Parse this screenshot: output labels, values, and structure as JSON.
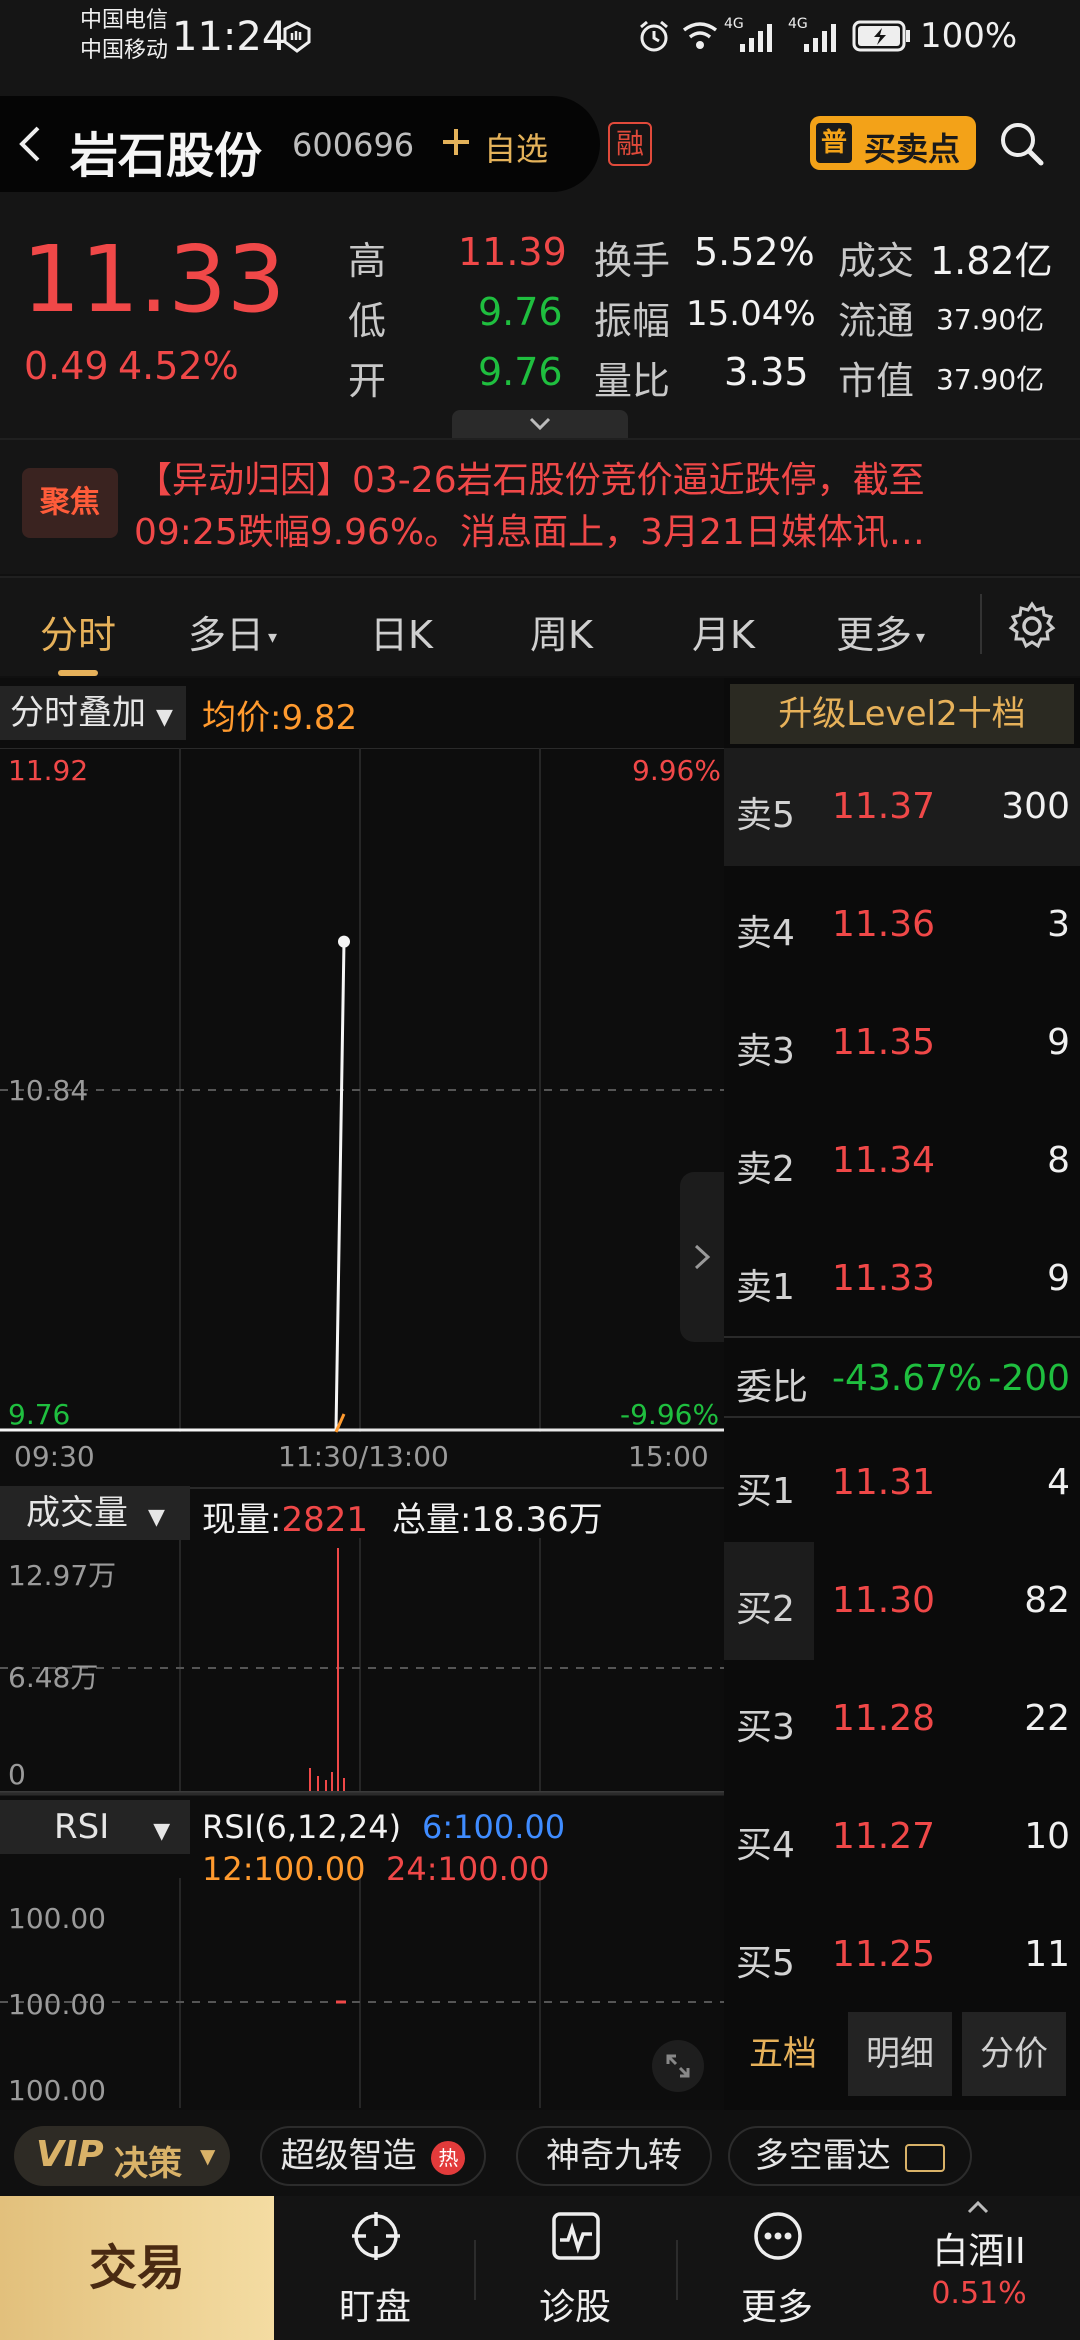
{
  "status_bar": {
    "carrier1": "中国电信",
    "carrier2": "中国移动",
    "time": "11:24",
    "network1": "4G",
    "network2": "4G",
    "battery": "100%"
  },
  "header": {
    "stock_name": "岩石股份",
    "stock_code": "600696",
    "add_watch": "自选",
    "margin_badge": "融",
    "buysell_prefix": "普",
    "buysell_label": "买卖点"
  },
  "quote": {
    "price": "11.33",
    "change": "0.49",
    "change_pct": "4.52%",
    "rows": [
      {
        "l1": "高",
        "v1": "11.39",
        "l2": "换手",
        "v2": "5.52%",
        "l3": "成交",
        "v3": "1.82亿"
      },
      {
        "l1": "低",
        "v1": "9.76",
        "l2": "振幅",
        "v2": "15.04%",
        "l3": "流通",
        "v3": "37.90亿"
      },
      {
        "l1": "开",
        "v1": "9.76",
        "l2": "量比",
        "v2": "3.35",
        "l3": "市值",
        "v3": "37.90亿"
      }
    ]
  },
  "news": {
    "badge": "聚焦",
    "line1": "【异动归因】03-26岩石股份竞价逼近跌停，截至",
    "line2": "09:25跌幅9.96%。消息面上，3月21日媒体讯…"
  },
  "tabs": [
    "分时",
    "多日",
    "日K",
    "周K",
    "月K",
    "更多"
  ],
  "chart": {
    "overlay_label": "分时叠加",
    "avg_label": "均价:9.82",
    "y_top": "11.92",
    "y_mid": "10.84",
    "y_bot": "9.76",
    "pct_top": "9.96%",
    "pct_bot": "-9.96%",
    "x_start": "09:30",
    "x_mid": "11:30/13:00",
    "x_end": "15:00",
    "volume_label": "成交量",
    "current_vol_label": "现量:",
    "current_vol": "2821",
    "total_vol": "总量:18.36万",
    "vol_top": "12.97万",
    "vol_mid": "6.48万",
    "vol_bot": "0",
    "rsi_label": "RSI",
    "rsi_params": "RSI(6,12,24)",
    "rsi6": "6:100.00",
    "rsi12": "12:100.00",
    "rsi24": "24:100.00",
    "rsi_top": "100.00",
    "rsi_mid": "100.00",
    "rsi_bot": "100.00"
  },
  "chart_data": {
    "type": "line",
    "x": [
      "09:30",
      "11:30/13:00",
      "15:00"
    ],
    "ylim": [
      9.76,
      11.92
    ],
    "series": [
      {
        "values": [
          9.76,
          9.76,
          11.33
        ]
      }
    ]
  },
  "order_book": {
    "upgrade": "升级Level2十档",
    "asks": [
      {
        "label": "卖5",
        "price": "11.37",
        "vol": "300"
      },
      {
        "label": "卖4",
        "price": "11.36",
        "vol": "3"
      },
      {
        "label": "卖3",
        "price": "11.35",
        "vol": "9"
      },
      {
        "label": "卖2",
        "price": "11.34",
        "vol": "8"
      },
      {
        "label": "卖1",
        "price": "11.33",
        "vol": "9"
      }
    ],
    "ratio_label": "委比",
    "ratio_value": "-43.67%",
    "ratio_diff": "-200",
    "bids": [
      {
        "label": "买1",
        "price": "11.31",
        "vol": "4"
      },
      {
        "label": "买2",
        "price": "11.30",
        "vol": "82"
      },
      {
        "label": "买3",
        "price": "11.28",
        "vol": "22"
      },
      {
        "label": "买4",
        "price": "11.27",
        "vol": "10"
      },
      {
        "label": "买5",
        "price": "11.25",
        "vol": "11"
      }
    ],
    "bottom_tabs": [
      "五档",
      "明细",
      "分价"
    ]
  },
  "chips": {
    "vip": "VIP",
    "vip_suffix": "决策",
    "c1": "超级智造",
    "c1_badge": "热",
    "c2": "神奇九转",
    "c3": "多空雷达"
  },
  "bottom_bar": {
    "trade": "交易",
    "watch": "盯盘",
    "diagnose": "诊股",
    "more": "更多",
    "sector": "白酒II",
    "sector_pct": "0.51%"
  },
  "colors": {
    "up": "#f04848",
    "down": "#1fbf3f",
    "accent": "#e6b15a"
  }
}
